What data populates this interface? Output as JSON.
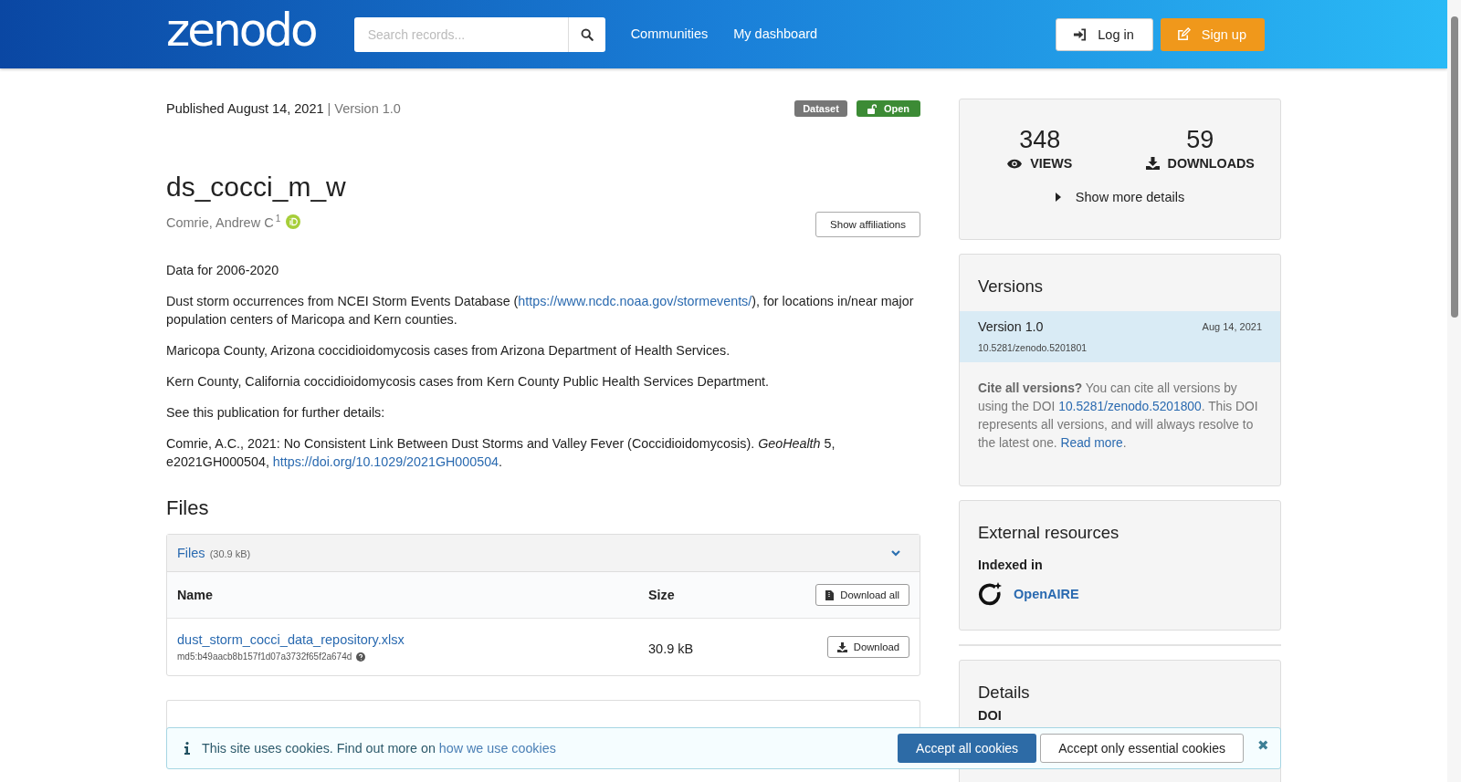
{
  "header": {
    "logo": "zenodo",
    "search": {
      "placeholder": "Search records..."
    },
    "nav": [
      "Communities",
      "My dashboard"
    ],
    "login": "Log in",
    "signup": "Sign up"
  },
  "record": {
    "published": "Published August 14, 2021",
    "version": "| Version 1.0",
    "badges": [
      {
        "label": "Dataset",
        "kind": "type"
      },
      {
        "label": "Open",
        "kind": "access"
      }
    ],
    "title": "ds_cocci_m_w",
    "author": "Comrie, Andrew C",
    "author_mark": "1",
    "affiliations_button": "Show affiliations",
    "description": [
      [
        {
          "kind": "text",
          "text": "Data for 2006-2020"
        }
      ],
      [
        {
          "kind": "text",
          "text": "Dust storm occurrences from NCEI Storm Events Database ("
        },
        {
          "kind": "link",
          "text": "https://www.ncdc.noaa.gov/stormevents/"
        },
        {
          "kind": "text",
          "text": "), for locations in/near major population centers of Maricopa and Kern counties."
        }
      ],
      [
        {
          "kind": "text",
          "text": "Maricopa County, Arizona coccidioidomycosis cases from Arizona Department of Health Services."
        }
      ],
      [
        {
          "kind": "text",
          "text": "Kern County, California coccidioidomycosis cases from Kern County Public Health Services Department."
        }
      ],
      [
        {
          "kind": "text",
          "text": "See this publication for further details:"
        }
      ],
      [
        {
          "kind": "text",
          "text": "Comrie, A.C., 2021: No Consistent Link Between Dust Storms and Valley Fever (Coccidioidomycosis). *GeoHealth* 5, e2021GH000504, "
        },
        {
          "kind": "link",
          "text": "https://doi.org/10.1029/2021GH000504"
        },
        {
          "kind": "text",
          "text": "."
        }
      ]
    ]
  },
  "files": {
    "heading": "Files",
    "panel_title": "Files",
    "panel_size": "(30.9 kB)",
    "expanded": true,
    "columns": [
      "Name",
      "Size"
    ],
    "download_all": "Download all",
    "rows": [
      {
        "name": "dust_storm_cocci_data_repository.xlsx",
        "checksum": "md5:b49aacb8b157f1d07a3732f65f2a674d",
        "size": "30.9 kB",
        "button": "Download"
      }
    ]
  },
  "stats": {
    "views": "348",
    "views_label": "VIEWS",
    "downloads": "59",
    "downloads_label": "DOWNLOADS",
    "more": "Show more details"
  },
  "versions": {
    "heading": "Versions",
    "items": [
      {
        "label": "Version 1.0",
        "date": "Aug 14, 2021",
        "doi": "10.5281/zenodo.5201801",
        "selected": true
      }
    ],
    "cite": [
      {
        "kind": "text",
        "text": "**Cite all versions?** You can cite all versions by using the DOI "
      },
      {
        "kind": "link",
        "text": "10.5281/zenodo.5201800"
      },
      {
        "kind": "text",
        "text": ". This DOI represents all versions, and will always resolve to the latest one. "
      },
      {
        "kind": "link",
        "text": "Read more"
      },
      {
        "kind": "text",
        "text": "."
      }
    ]
  },
  "external": {
    "heading": "External resources",
    "subheading": "Indexed in",
    "items": [
      "OpenAIRE"
    ]
  },
  "details": {
    "heading": "Details",
    "labels": [
      "DOI"
    ]
  },
  "cookies": {
    "text": "This site uses cookies. Find out more on ",
    "link": "how we use cookies",
    "accept_all": "Accept all cookies",
    "accept_essential": "Accept only essential cookies",
    "close": "✖"
  }
}
